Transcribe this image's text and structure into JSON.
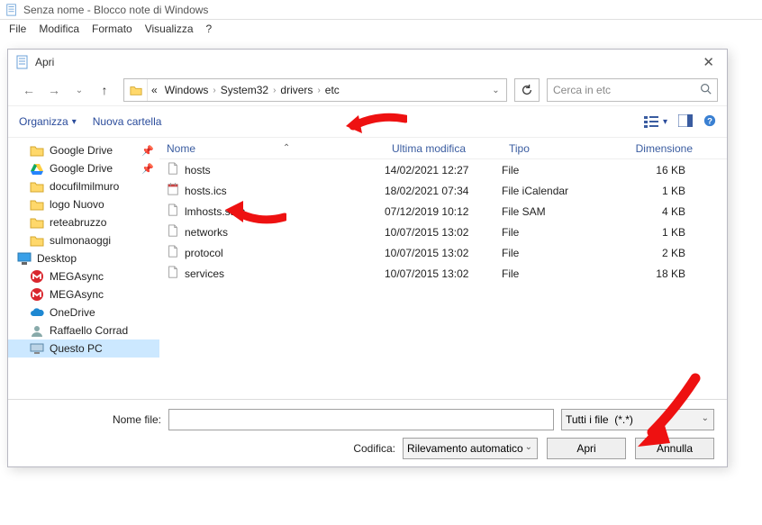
{
  "notepad": {
    "title": "Senza nome - Blocco note di Windows",
    "menu": [
      "File",
      "Modifica",
      "Formato",
      "Visualizza",
      "?"
    ]
  },
  "dialog": {
    "title": "Apri",
    "breadcrumb_prefix": "«",
    "breadcrumbs": [
      "Windows",
      "System32",
      "drivers",
      "etc"
    ],
    "search_placeholder": "Cerca in etc",
    "toolbar": {
      "organize": "Organizza",
      "new_folder": "Nuova cartella"
    },
    "columns": {
      "name": "Nome",
      "modified": "Ultima modifica",
      "type": "Tipo",
      "size": "Dimensione"
    },
    "tree": [
      {
        "label": "Google Drive",
        "icon": "folder",
        "pin": true
      },
      {
        "label": "Google Drive",
        "icon": "gdrive",
        "pin": true
      },
      {
        "label": "docufilmilmuro",
        "icon": "folder"
      },
      {
        "label": "logo Nuovo",
        "icon": "folder"
      },
      {
        "label": "reteabruzzo",
        "icon": "folder"
      },
      {
        "label": "sulmonaoggi",
        "icon": "folder"
      },
      {
        "label": "Desktop",
        "icon": "desktop",
        "indent": -1
      },
      {
        "label": "MEGAsync",
        "icon": "mega"
      },
      {
        "label": "MEGAsync",
        "icon": "mega"
      },
      {
        "label": "OneDrive",
        "icon": "onedrive"
      },
      {
        "label": "Raffaello Corrad",
        "icon": "user"
      },
      {
        "label": "Questo PC",
        "icon": "pc",
        "selected": true
      }
    ],
    "files": [
      {
        "name": "hosts",
        "mod": "14/02/2021 12:27",
        "type": "File",
        "size": "16 KB",
        "icon": "file"
      },
      {
        "name": "hosts.ics",
        "mod": "18/02/2021 07:34",
        "type": "File iCalendar",
        "size": "1 KB",
        "icon": "cal"
      },
      {
        "name": "lmhosts.sam",
        "mod": "07/12/2019 10:12",
        "type": "File SAM",
        "size": "4 KB",
        "icon": "file"
      },
      {
        "name": "networks",
        "mod": "10/07/2015 13:02",
        "type": "File",
        "size": "1 KB",
        "icon": "file"
      },
      {
        "name": "protocol",
        "mod": "10/07/2015 13:02",
        "type": "File",
        "size": "2 KB",
        "icon": "file"
      },
      {
        "name": "services",
        "mod": "10/07/2015 13:02",
        "type": "File",
        "size": "18 KB",
        "icon": "file"
      }
    ],
    "filename_label": "Nome file:",
    "encoding_label": "Codifica:",
    "encoding_value": "Rilevamento automatico",
    "filter_value": "Tutti i file  (*.*)",
    "open_btn": "Apri",
    "cancel_btn": "Annulla"
  }
}
